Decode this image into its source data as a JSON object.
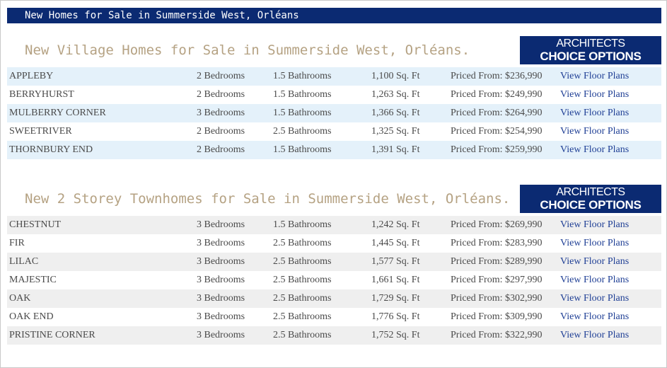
{
  "header": {
    "title": "New Homes for Sale in Summerside West, Orléans"
  },
  "badge": {
    "line1": "ARCHITECTS",
    "line2": "CHOICE OPTIONS"
  },
  "village": {
    "title": "New Village Homes for Sale in Summerside West, Orléans.",
    "rows": [
      {
        "name": "APPLEBY",
        "bedrooms": "2  Bedrooms",
        "bathrooms": "1.5  Bathrooms",
        "sqft": "1,100 Sq. Ft",
        "price": "Priced From: $236,990",
        "link": "View Floor Plans"
      },
      {
        "name": "BERRYHURST",
        "bedrooms": "2  Bedrooms",
        "bathrooms": "1.5  Bathrooms",
        "sqft": "1,263 Sq. Ft",
        "price": "Priced From: $249,990",
        "link": "View Floor Plans"
      },
      {
        "name": "MULBERRY CORNER",
        "bedrooms": "3  Bedrooms",
        "bathrooms": "1.5  Bathrooms",
        "sqft": "1,366 Sq. Ft",
        "price": "Priced From: $264,990",
        "link": "View Floor Plans"
      },
      {
        "name": "SWEETRIVER",
        "bedrooms": "2  Bedrooms",
        "bathrooms": "2.5  Bathrooms",
        "sqft": "1,325 Sq. Ft",
        "price": "Priced From: $254,990",
        "link": "View Floor Plans"
      },
      {
        "name": "THORNBURY END",
        "bedrooms": "2  Bedrooms",
        "bathrooms": "1.5  Bathrooms",
        "sqft": "1,391 Sq. Ft",
        "price": "Priced From: $259,990",
        "link": "View Floor Plans"
      }
    ]
  },
  "townhomes": {
    "title": "New 2 Storey Townhomes for Sale in Summerside West, Orléans.",
    "rows": [
      {
        "name": "CHESTNUT",
        "bedrooms": "3  Bedrooms",
        "bathrooms": "1.5  Bathrooms",
        "sqft": "1,242 Sq. Ft",
        "price": "Priced From: $269,990",
        "link": "View Floor Plans"
      },
      {
        "name": "FIR",
        "bedrooms": "3  Bedrooms",
        "bathrooms": "2.5  Bathrooms",
        "sqft": "1,445 Sq. Ft",
        "price": "Priced From: $283,990",
        "link": "View Floor Plans"
      },
      {
        "name": "LILAC",
        "bedrooms": "3  Bedrooms",
        "bathrooms": "2.5  Bathrooms",
        "sqft": "1,577 Sq. Ft",
        "price": "Priced From: $289,990",
        "link": "View Floor Plans"
      },
      {
        "name": "MAJESTIC",
        "bedrooms": "3  Bedrooms",
        "bathrooms": "2.5  Bathrooms",
        "sqft": "1,661 Sq. Ft",
        "price": "Priced From: $297,990",
        "link": "View Floor Plans"
      },
      {
        "name": "OAK",
        "bedrooms": "3  Bedrooms",
        "bathrooms": "2.5  Bathrooms",
        "sqft": "1,729 Sq. Ft",
        "price": "Priced From: $302,990",
        "link": "View Floor Plans"
      },
      {
        "name": "OAK END",
        "bedrooms": "3  Bedrooms",
        "bathrooms": "2.5  Bathrooms",
        "sqft": "1,776 Sq. Ft",
        "price": "Priced From: $309,990",
        "link": "View Floor Plans"
      },
      {
        "name": "PRISTINE CORNER",
        "bedrooms": "3  Bedrooms",
        "bathrooms": "2.5  Bathrooms",
        "sqft": "1,752 Sq. Ft",
        "price": "Priced From: $322,990",
        "link": "View Floor Plans"
      }
    ]
  },
  "colors": {
    "navy": "#0b2a72",
    "title_tan": "#b5a283",
    "link_blue": "#1f3f95",
    "row_blue": "#e4f1fa",
    "row_gray": "#efefef"
  }
}
